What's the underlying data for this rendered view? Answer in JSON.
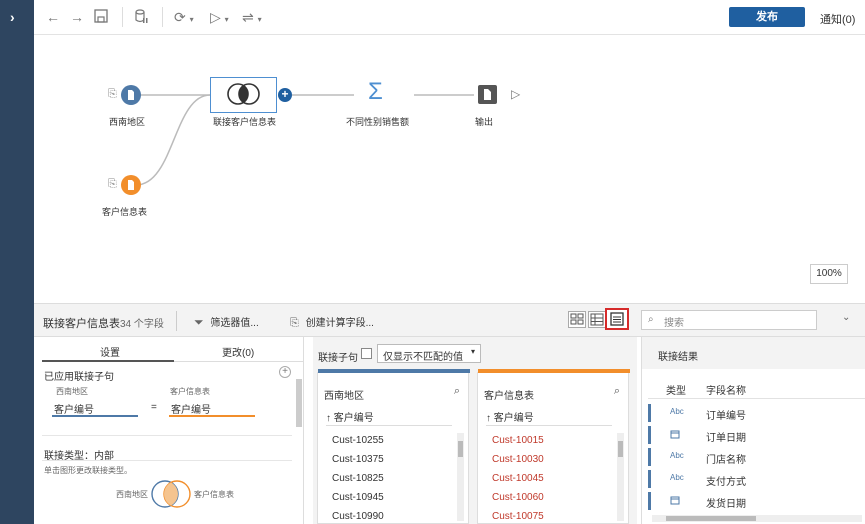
{
  "toolbar": {
    "publish_label": "发布",
    "notify_label": "通知(0)"
  },
  "canvas": {
    "nodes": {
      "southwest": "西南地区",
      "customer": "客户信息表",
      "join": "联接客户信息表",
      "aggregate": "不同性别销售额",
      "output": "输出"
    },
    "zoom": "100%"
  },
  "panel": {
    "title": "联接客户信息表",
    "field_count": "34 个字段",
    "filter_label": "筛选器值...",
    "calc_label": "创建计算字段...",
    "search_placeholder": "搜索"
  },
  "settings": {
    "tab_settings": "设置",
    "tab_changes": "更改(0)",
    "applied_clause": "已应用联接子句",
    "left_table": "西南地区",
    "right_table": "客户信息表",
    "left_field": "客户编号",
    "equals": "=",
    "right_field": "客户编号",
    "join_type": "联接类型：内部",
    "hint": "单击图形更改联接类型。",
    "venn_left": "西南地区",
    "venn_right": "客户信息表"
  },
  "join_clause": {
    "title": "联接子句",
    "unmatched_label": "仅显示不匹配的值",
    "left": {
      "table": "西南地区",
      "field": "↑ 客户编号",
      "values": [
        "Cust-10255",
        "Cust-10375",
        "Cust-10825",
        "Cust-10945",
        "Cust-10990"
      ]
    },
    "right": {
      "table": "客户信息表",
      "field": "↑ 客户编号",
      "values": [
        "Cust-10015",
        "Cust-10030",
        "Cust-10045",
        "Cust-10060",
        "Cust-10075"
      ]
    }
  },
  "results": {
    "title": "联接结果",
    "col_type": "类型",
    "col_name": "字段名称",
    "rows": [
      {
        "type": "Abc",
        "name": "订单编号"
      },
      {
        "type": "📅",
        "name": "订单日期"
      },
      {
        "type": "Abc",
        "name": "门店名称"
      },
      {
        "type": "Abc",
        "name": "支付方式"
      },
      {
        "type": "📅",
        "name": "发货日期"
      }
    ]
  },
  "colors": {
    "rail": "#2e4560",
    "blue_node": "#4e79a7",
    "orange_node": "#f28e2b",
    "publish": "#1f5fa0",
    "unmatched_red": "#c0392b"
  }
}
